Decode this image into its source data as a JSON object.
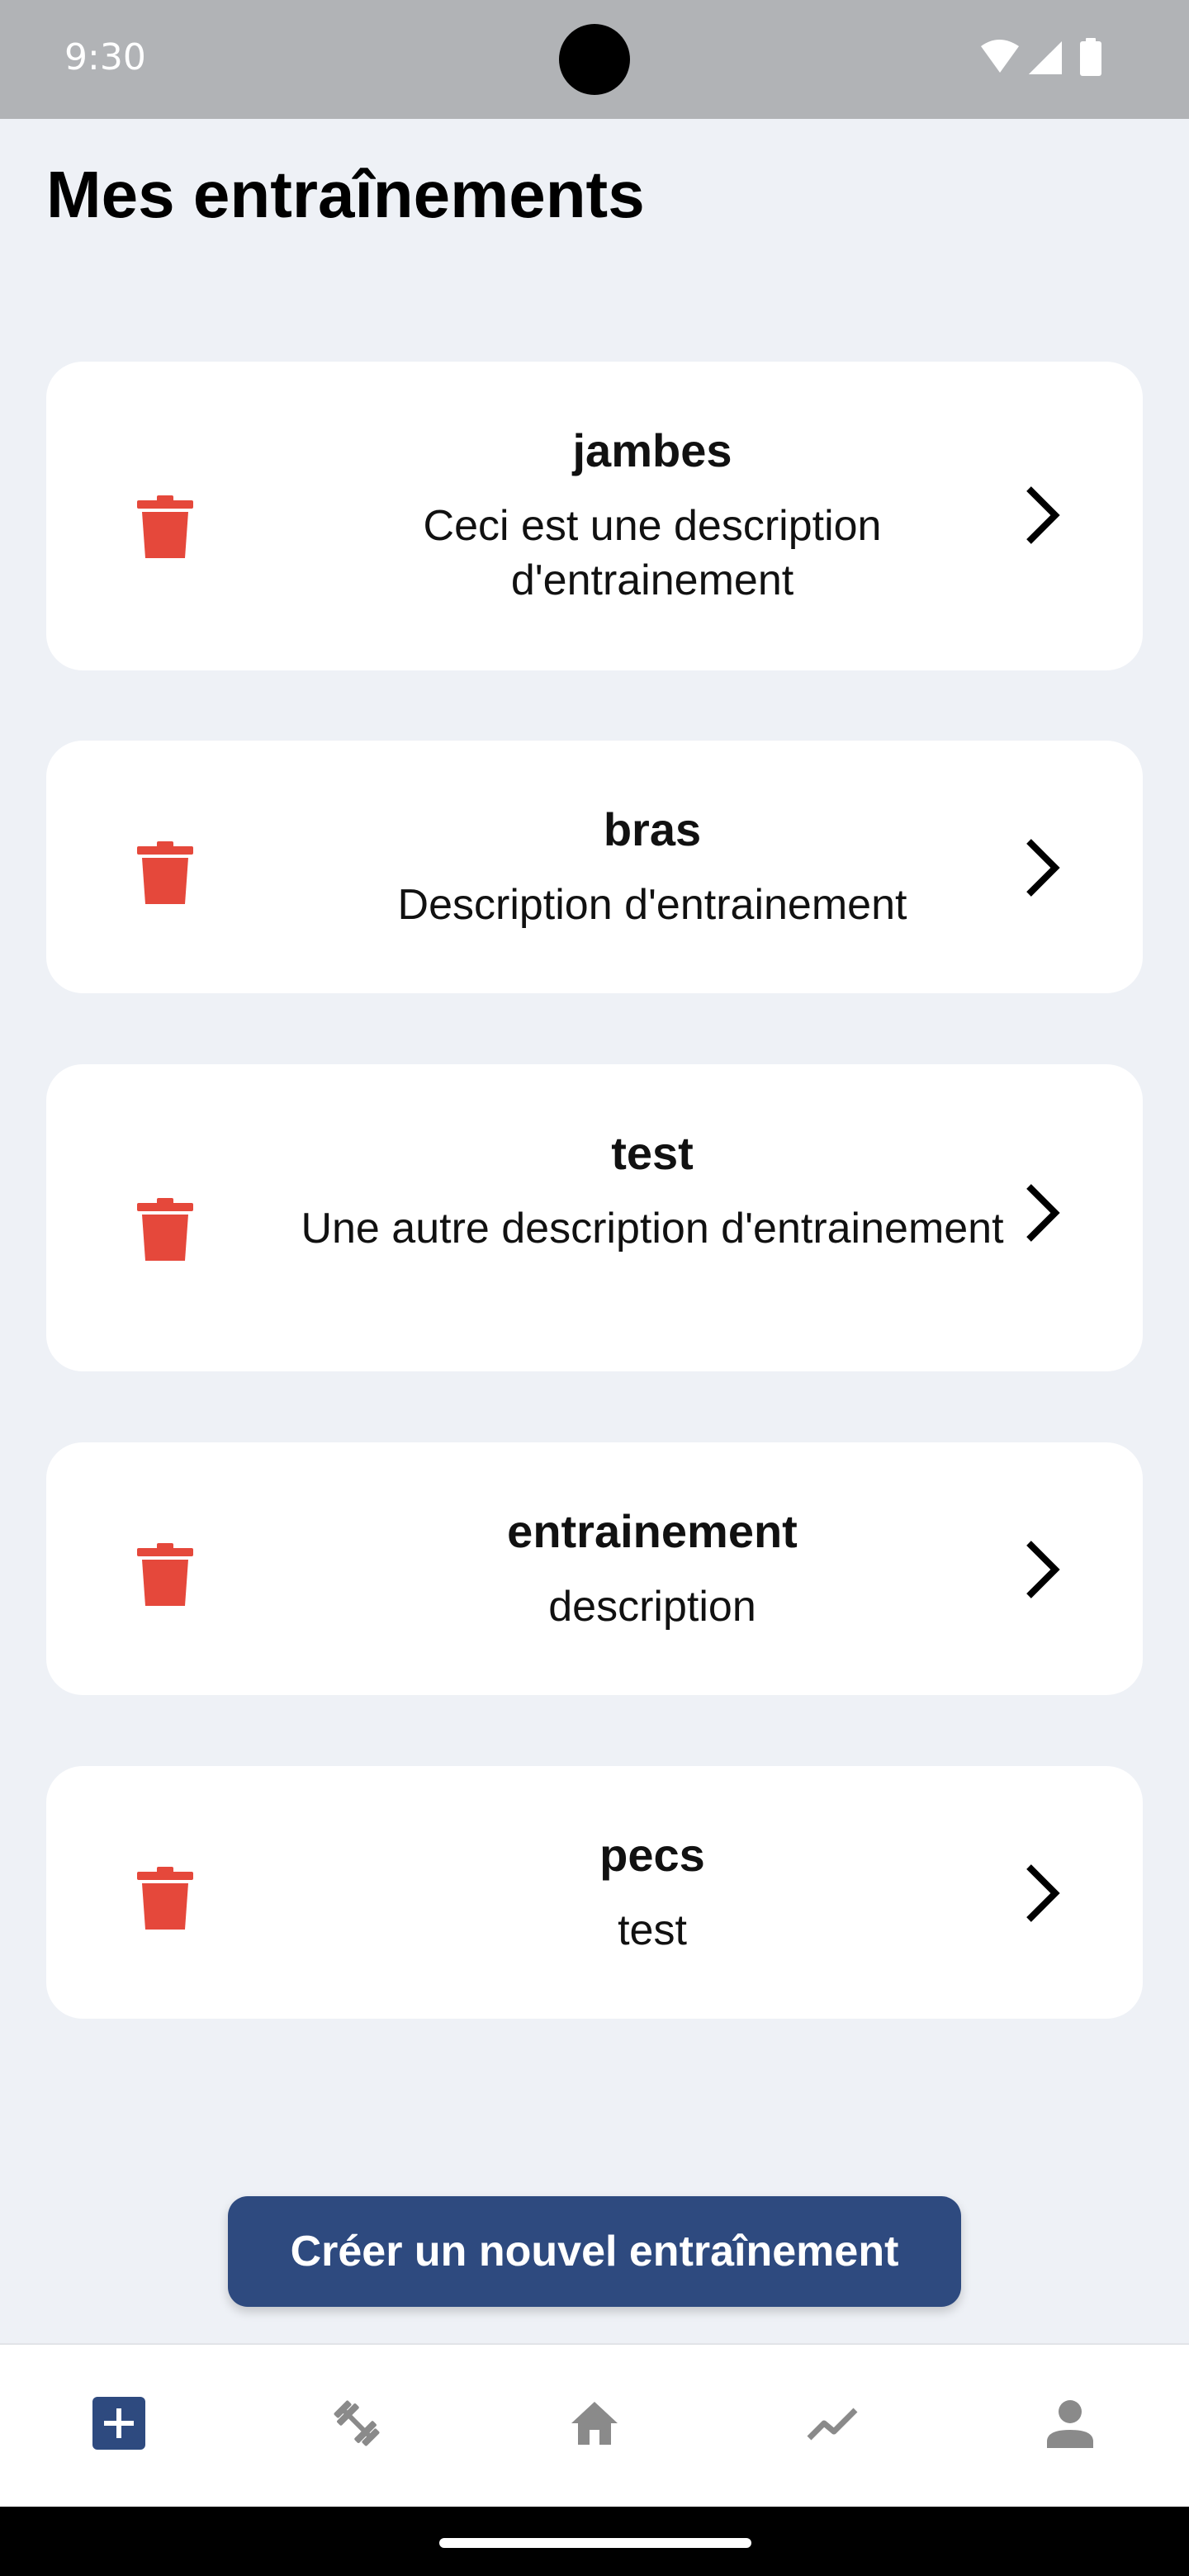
{
  "status_bar": {
    "time": "9:30"
  },
  "page": {
    "title": "Mes entraînements"
  },
  "workouts": [
    {
      "title": "jambes",
      "description": "Ceci est une description d'entrainement"
    },
    {
      "title": "bras",
      "description": "Description d'entrainement"
    },
    {
      "title": "test",
      "description": "Une autre description d'entrainement"
    },
    {
      "title": "entrainement",
      "description": "description"
    },
    {
      "title": "pecs",
      "description": "test"
    }
  ],
  "create_button": {
    "label": "Créer un nouvel entraînement"
  },
  "bottom_nav": {
    "items": [
      {
        "icon": "add-box-icon",
        "active": true
      },
      {
        "icon": "dumbbell-icon",
        "active": false
      },
      {
        "icon": "home-icon",
        "active": false
      },
      {
        "icon": "trending-up-icon",
        "active": false
      },
      {
        "icon": "person-icon",
        "active": false
      }
    ]
  },
  "colors": {
    "background": "#eef1f6",
    "card": "#ffffff",
    "primary": "#2e4a7f",
    "delete": "#e5483b",
    "nav_inactive": "#8a8a8a",
    "status_bar": "#b1b3b6"
  }
}
